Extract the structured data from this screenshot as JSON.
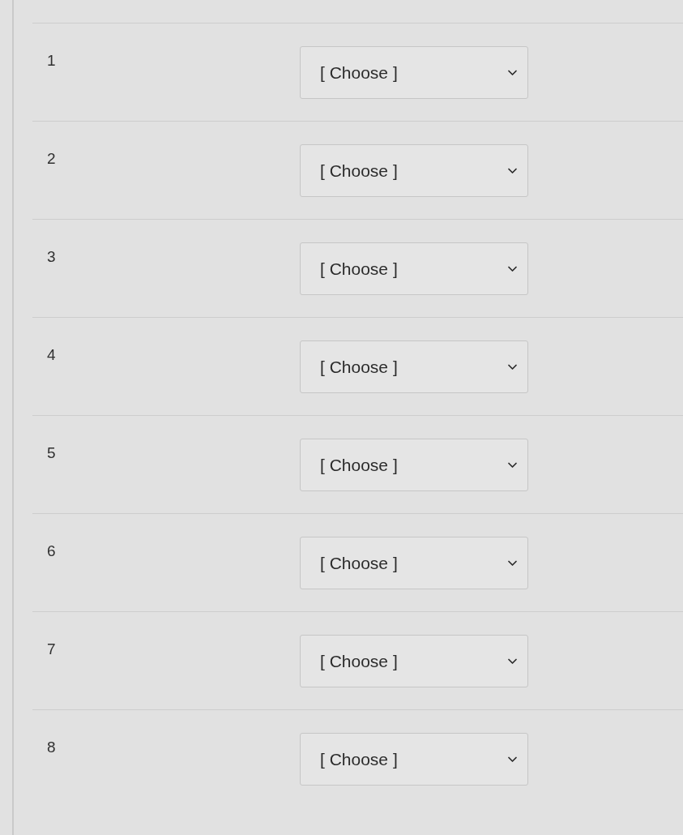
{
  "rows": [
    {
      "number": "1",
      "dropdown": {
        "value": "[ Choose ]"
      }
    },
    {
      "number": "2",
      "dropdown": {
        "value": "[ Choose ]"
      }
    },
    {
      "number": "3",
      "dropdown": {
        "value": "[ Choose ]"
      }
    },
    {
      "number": "4",
      "dropdown": {
        "value": "[ Choose ]"
      }
    },
    {
      "number": "5",
      "dropdown": {
        "value": "[ Choose ]"
      }
    },
    {
      "number": "6",
      "dropdown": {
        "value": "[ Choose ]"
      }
    },
    {
      "number": "7",
      "dropdown": {
        "value": "[ Choose ]"
      }
    },
    {
      "number": "8",
      "dropdown": {
        "value": "[ Choose ]"
      }
    }
  ]
}
